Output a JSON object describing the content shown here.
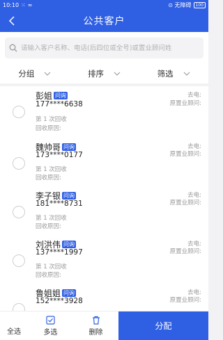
{
  "statusbar": {
    "time": "10:10",
    "signal": "⁙",
    "wifi": "≈",
    "carrier": "⊙ 无障碍",
    "battery": "100"
  },
  "header": {
    "title": "公共客户"
  },
  "search": {
    "placeholder": "请输入客户名称、电话(后四位或全号)或置业顾问姓"
  },
  "filters": [
    {
      "label": "分组"
    },
    {
      "label": "排序"
    },
    {
      "label": "筛选"
    }
  ],
  "customers": [
    {
      "name": "彭姐",
      "tag": "问询",
      "phone": "177****6638",
      "recycle_count": "第 1 次回收",
      "recycle_reason": "回收原因:",
      "last_call": "去电:",
      "original_consultant": "原置业顾问:"
    },
    {
      "name": "魏帅哥",
      "tag": "问询",
      "phone": "173****0177",
      "recycle_count": "第 1 次回收",
      "recycle_reason": "回收原因:",
      "last_call": "去电:",
      "original_consultant": "原置业顾问:"
    },
    {
      "name": "李子银",
      "tag": "问询",
      "phone": "181****8731",
      "recycle_count": "第 1 次回收",
      "recycle_reason": "回收原因:",
      "last_call": "去电:",
      "original_consultant": "原置业顾问:"
    },
    {
      "name": "刘洪伟",
      "tag": "问询",
      "phone": "137****1997",
      "recycle_count": "第 1 次回收",
      "recycle_reason": "回收原因:",
      "last_call": "去电:",
      "original_consultant": "原置业顾问:"
    },
    {
      "name": "鲁姐姐",
      "tag": "问询",
      "phone": "152****3928",
      "last_call": "去电:",
      "original_consultant": "原置业顾问:"
    }
  ],
  "bottom": {
    "select_all": "全选",
    "multi_select": "多选",
    "delete": "删除",
    "assign": "分配"
  },
  "colors": {
    "accent": "#2f5fe3",
    "background": "#f2f2f5"
  },
  "icons": {
    "back": "chevron-left-icon",
    "search": "search-icon",
    "filter_arrow": "chevron-down-icon",
    "multi": "checklist-icon",
    "delete": "trash-icon"
  }
}
